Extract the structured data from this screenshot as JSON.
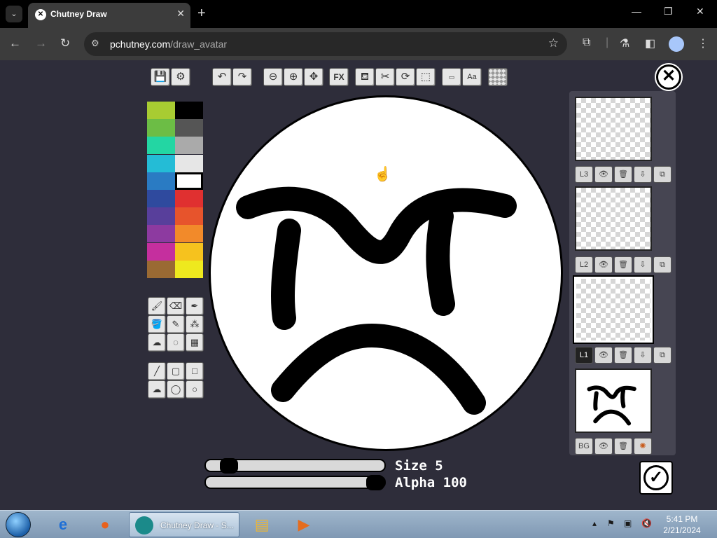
{
  "browser": {
    "tab_title": "Chutney Draw",
    "url_host": "pchutney.com",
    "url_path": "/draw_avatar"
  },
  "toolbar_top": {
    "groups": [
      {
        "items": [
          "save-icon",
          "settings-gear-icon"
        ]
      },
      {
        "items": [
          "undo-icon",
          "redo-icon"
        ]
      },
      {
        "items": [
          "zoom-out-icon",
          "zoom-in-icon",
          "move-icon"
        ]
      },
      {
        "items": [
          "fx-icon"
        ]
      },
      {
        "items": [
          "stamp-icon",
          "scissors-select-icon",
          "rotate-icon",
          "crop-icon"
        ]
      },
      {
        "items": [
          "text-small-icon",
          "text-aa-icon"
        ]
      },
      {
        "items": [
          "transparency-grid-icon"
        ]
      }
    ],
    "fx_label": "FX",
    "aa_label": "Aa"
  },
  "palette": {
    "colors_left": [
      "#a8cc32",
      "#6cbd45",
      "#23d6a3",
      "#24bcd6",
      "#2a7bc3",
      "#2f4a9e",
      "#583f9b",
      "#8d3aa0",
      "#c52f9e",
      "#9a6a33"
    ],
    "colors_right": [
      "#000000",
      "#555555",
      "#aaaaaa",
      "#e6e6e6",
      "#ffffff",
      "#e03030",
      "#e7542c",
      "#f28a2a",
      "#f6c21e",
      "#eee91e"
    ],
    "selected": "#ffffff"
  },
  "tools": {
    "rows": [
      [
        "brush-icon",
        "eraser-icon",
        "pen-icon"
      ],
      [
        "fill-bucket-icon",
        "pencil-icon",
        "spray-icon"
      ],
      [
        "smudge-icon",
        "blur-icon",
        "pattern-brush-icon"
      ],
      [
        "line-icon",
        "rectangle-outline-icon",
        "rectangle-filled-icon"
      ],
      [
        "blob-icon",
        "circle-outline-icon",
        "circle-filled-icon"
      ]
    ]
  },
  "sliders": {
    "size_label": "Size 5",
    "alpha_label": "Alpha 100",
    "size_value": 5,
    "alpha_value": 100
  },
  "layers": [
    {
      "label": "L3",
      "active": false
    },
    {
      "label": "L2",
      "active": false
    },
    {
      "label": "L1",
      "active": true
    },
    {
      "label": "BG",
      "active": false
    }
  ],
  "taskbar": {
    "active_window": "Chutney Draw - S...",
    "time": "5:41 PM",
    "date": "2/21/2024"
  }
}
